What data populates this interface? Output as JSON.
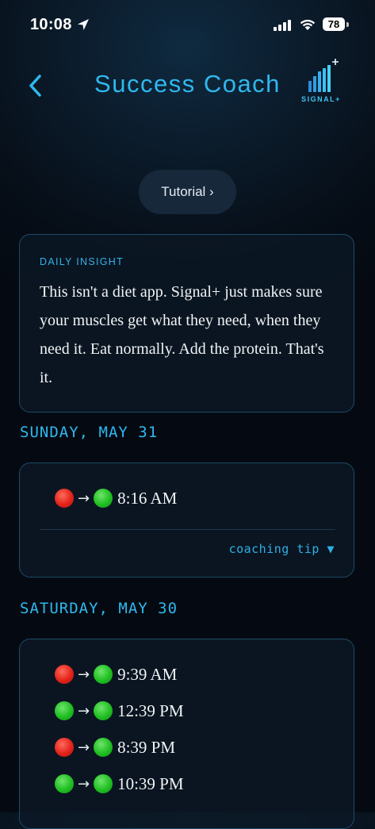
{
  "status_bar": {
    "time": "10:08",
    "battery": "78"
  },
  "header": {
    "title": "Success Coach",
    "logo_text": "SIGNAL+"
  },
  "tutorial": {
    "label": "Tutorial ›"
  },
  "insight": {
    "label": "DAILY INSIGHT",
    "text": "This isn't a diet app. Signal+ just makes sure your muscles get what they need, when they need it. Eat normally. Add the protein. That's it."
  },
  "days": [
    {
      "header": "SUNDAY, MAY 31",
      "entries": [
        {
          "from": "red",
          "to": "green",
          "arrow": "→",
          "time": "8:16 AM"
        }
      ],
      "tip_label": "coaching tip ▼"
    },
    {
      "header": "SATURDAY, MAY 30",
      "entries": [
        {
          "from": "red",
          "to": "green",
          "arrow": "→",
          "time": "9:39 AM"
        },
        {
          "from": "green",
          "to": "green",
          "arrow": "→",
          "time": "12:39 PM"
        },
        {
          "from": "red",
          "to": "green",
          "arrow": "→",
          "time": "8:39 PM"
        },
        {
          "from": "green",
          "to": "green",
          "arrow": "→",
          "time": "10:39 PM"
        }
      ]
    }
  ],
  "colors": {
    "accent": "#2fb8ee",
    "status_red": "#e3231b",
    "status_green": "#1fbf22",
    "card_border": "#1e4a66"
  },
  "icons": [
    "location-arrow-icon",
    "cellular-signal-icon",
    "wifi-icon",
    "battery-icon",
    "back-chevron-icon",
    "signal-plus-logo"
  ]
}
